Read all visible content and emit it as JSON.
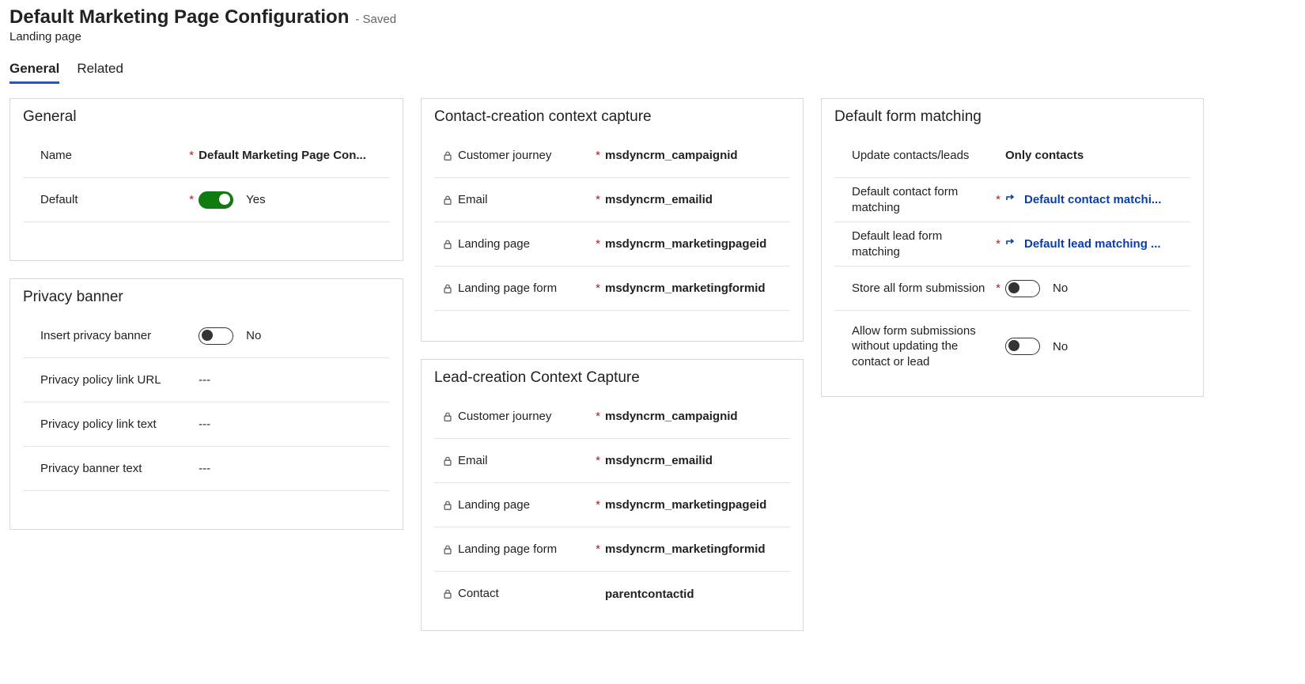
{
  "header": {
    "title": "Default Marketing Page Configuration",
    "saved": "- Saved",
    "entity": "Landing page"
  },
  "tabs": {
    "general": "General",
    "related": "Related"
  },
  "cards": {
    "general": {
      "title": "General",
      "name_label": "Name",
      "name_value": "Default Marketing Page Con...",
      "default_label": "Default",
      "default_toggle_text": "Yes"
    },
    "privacy": {
      "title": "Privacy banner",
      "insert_label": "Insert privacy banner",
      "insert_toggle_text": "No",
      "url_label": "Privacy policy link URL",
      "url_value": "---",
      "text_label": "Privacy policy link text",
      "text_value": "---",
      "banner_label": "Privacy banner text",
      "banner_value": "---"
    },
    "ccc": {
      "title": "Contact-creation context capture",
      "fields": [
        {
          "label": "Customer journey",
          "value": "msdyncrm_campaignid"
        },
        {
          "label": "Email",
          "value": "msdyncrm_emailid"
        },
        {
          "label": "Landing page",
          "value": "msdyncrm_marketingpageid"
        },
        {
          "label": "Landing page form",
          "value": "msdyncrm_marketingformid"
        }
      ]
    },
    "lcc": {
      "title": "Lead-creation Context Capture",
      "fields": [
        {
          "label": "Customer journey",
          "value": "msdyncrm_campaignid",
          "req": true
        },
        {
          "label": "Email",
          "value": "msdyncrm_emailid",
          "req": true
        },
        {
          "label": "Landing page",
          "value": "msdyncrm_marketingpageid",
          "req": true
        },
        {
          "label": "Landing page form",
          "value": "msdyncrm_marketingformid",
          "req": true
        },
        {
          "label": "Contact",
          "value": "parentcontactid",
          "req": false
        }
      ]
    },
    "dfm": {
      "title": "Default form matching",
      "update_label": "Update contacts/leads",
      "update_value": "Only contacts",
      "contact_match_label": "Default contact form matching",
      "contact_match_value": "Default contact matchi...",
      "lead_match_label": "Default lead form matching",
      "lead_match_value": "Default lead matching ...",
      "store_label": "Store all form submission",
      "store_toggle_text": "No",
      "allow_label": "Allow form submissions without updating the contact or lead",
      "allow_toggle_text": "No"
    }
  }
}
